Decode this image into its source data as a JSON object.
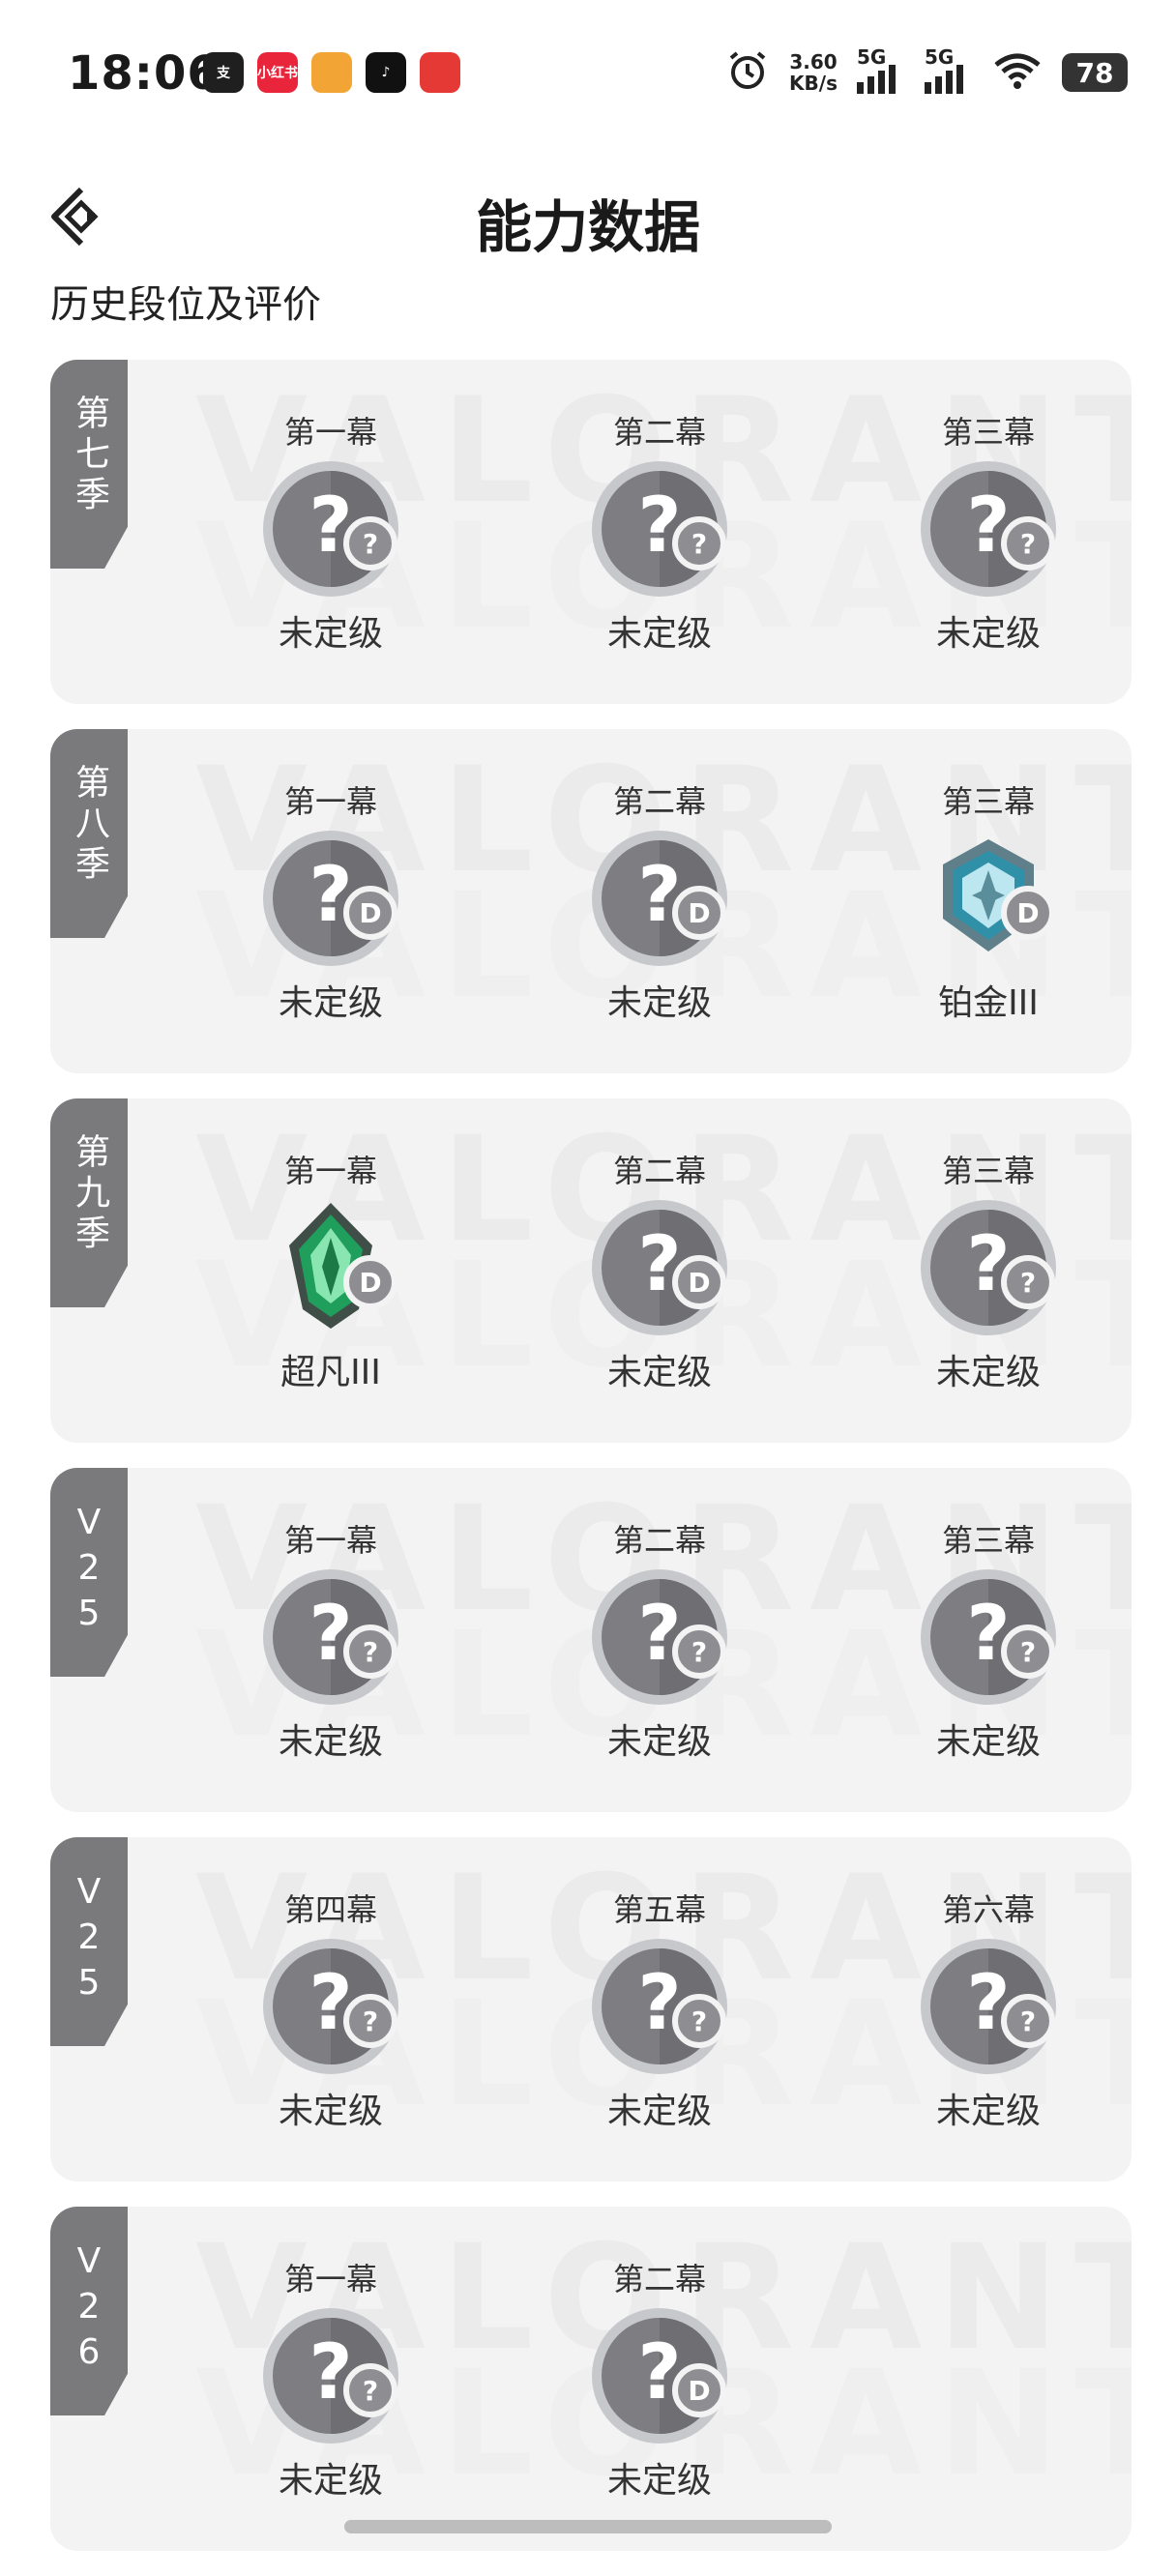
{
  "status_bar": {
    "time": "18:06",
    "apps": [
      {
        "icon": "alipay-icon",
        "label": "支",
        "color": "#1f1f1f"
      },
      {
        "icon": "xiaohongshu-icon",
        "label": "小红书",
        "color": "#e8253a"
      },
      {
        "icon": "orange-app-icon",
        "label": "",
        "color": "#f2a534"
      },
      {
        "icon": "douyin-icon",
        "label": "♪",
        "color": "#111111"
      },
      {
        "icon": "red-app-icon",
        "label": "",
        "color": "#e53935"
      }
    ],
    "speed_value": "3.60",
    "speed_unit": "KB/s",
    "signal1": "5G",
    "signal2": "5G",
    "battery": "78"
  },
  "nav": {
    "title": "能力数据"
  },
  "section": {
    "title": "历史段位及评价"
  },
  "seasons": [
    {
      "tag": "第七季",
      "acts": [
        {
          "label": "第一幕",
          "rank": "未定级",
          "type": "unranked",
          "badge": "?"
        },
        {
          "label": "第二幕",
          "rank": "未定级",
          "type": "unranked",
          "badge": "?"
        },
        {
          "label": "第三幕",
          "rank": "未定级",
          "type": "unranked",
          "badge": "?"
        }
      ]
    },
    {
      "tag": "第八季",
      "acts": [
        {
          "label": "第一幕",
          "rank": "未定级",
          "type": "unranked",
          "badge": "D"
        },
        {
          "label": "第二幕",
          "rank": "未定级",
          "type": "unranked",
          "badge": "D"
        },
        {
          "label": "第三幕",
          "rank": "铂金III",
          "type": "platinum",
          "badge": "D"
        }
      ]
    },
    {
      "tag": "第九季",
      "acts": [
        {
          "label": "第一幕",
          "rank": "超凡III",
          "type": "ascendant",
          "badge": "D"
        },
        {
          "label": "第二幕",
          "rank": "未定级",
          "type": "unranked",
          "badge": "D"
        },
        {
          "label": "第三幕",
          "rank": "未定级",
          "type": "unranked",
          "badge": "?"
        }
      ]
    },
    {
      "tag": "V25",
      "acts": [
        {
          "label": "第一幕",
          "rank": "未定级",
          "type": "unranked",
          "badge": "?"
        },
        {
          "label": "第二幕",
          "rank": "未定级",
          "type": "unranked",
          "badge": "?"
        },
        {
          "label": "第三幕",
          "rank": "未定级",
          "type": "unranked",
          "badge": "?"
        }
      ]
    },
    {
      "tag": "V25",
      "acts": [
        {
          "label": "第四幕",
          "rank": "未定级",
          "type": "unranked",
          "badge": "?"
        },
        {
          "label": "第五幕",
          "rank": "未定级",
          "type": "unranked",
          "badge": "?"
        },
        {
          "label": "第六幕",
          "rank": "未定级",
          "type": "unranked",
          "badge": "?"
        }
      ]
    },
    {
      "tag": "V26",
      "acts": [
        {
          "label": "第一幕",
          "rank": "未定级",
          "type": "unranked",
          "badge": "?"
        },
        {
          "label": "第二幕",
          "rank": "未定级",
          "type": "unranked",
          "badge": "D"
        }
      ]
    }
  ],
  "colors": {
    "card_bg": "#f3f3f4",
    "tag_bg": "#7a7a7c",
    "unranked_disc": "#7d7d82",
    "platinum": "#3a8fa3",
    "ascendant": "#2e9e5b"
  }
}
